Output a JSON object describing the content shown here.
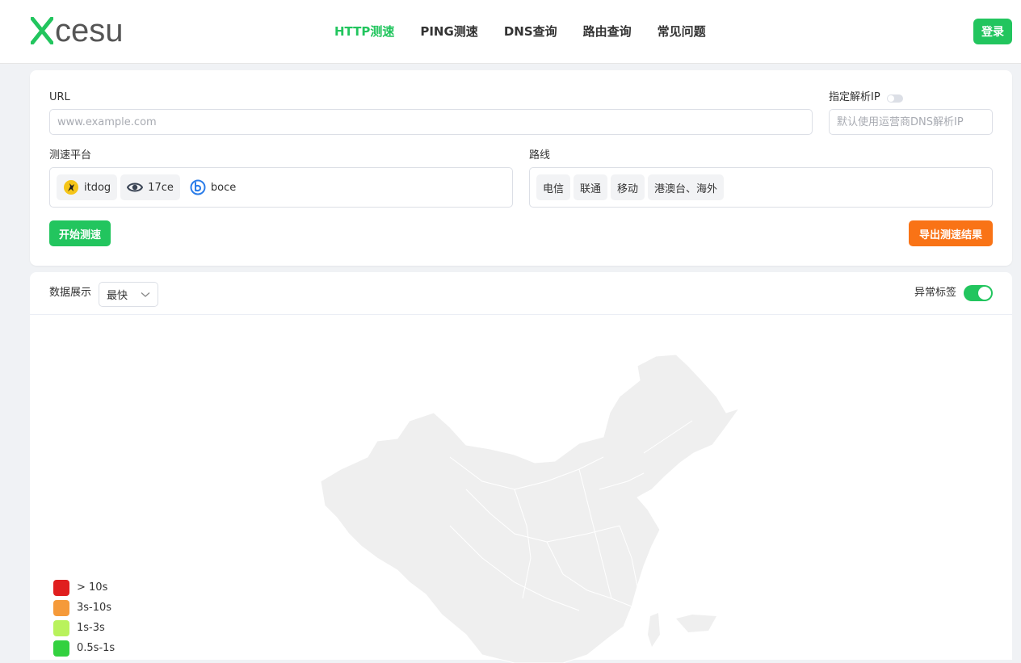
{
  "header": {
    "logo_text": "cesu",
    "nav": [
      {
        "label": "HTTP测速",
        "active": true
      },
      {
        "label": "PING测速",
        "active": false
      },
      {
        "label": "DNS查询",
        "active": false
      },
      {
        "label": "路由查询",
        "active": false
      },
      {
        "label": "常见问题",
        "active": false
      }
    ],
    "login_label": "登录"
  },
  "form": {
    "url_label": "URL",
    "url_placeholder": "www.example.com",
    "url_value": "",
    "ip_label": "指定解析IP",
    "ip_placeholder": "默认使用运营商DNS解析IP",
    "platform_label": "测速平台",
    "platforms": [
      {
        "label": "itdog",
        "icon": "itdog-icon",
        "selected": true
      },
      {
        "label": "17ce",
        "icon": "eye-icon",
        "selected": true
      },
      {
        "label": "boce",
        "icon": "boce-icon",
        "selected": false
      }
    ],
    "route_label": "路线",
    "routes": [
      "电信",
      "联通",
      "移动",
      "港澳台、海外"
    ],
    "start_label": "开始测速",
    "export_label": "导出测速结果"
  },
  "display": {
    "label": "数据展示",
    "select_value": "最快",
    "abnormal_label": "异常标签",
    "abnormal_on": true
  },
  "legend": [
    {
      "label": "> 10s",
      "color": "#e01f1f"
    },
    {
      "label": "3s-10s",
      "color": "#f59a3a"
    },
    {
      "label": "1s-3s",
      "color": "#b9f25c"
    },
    {
      "label": "0.5s-1s",
      "color": "#33d13f"
    }
  ],
  "colors": {
    "accent": "#22c55e",
    "export": "#f97316",
    "map_fill": "#efefef"
  }
}
